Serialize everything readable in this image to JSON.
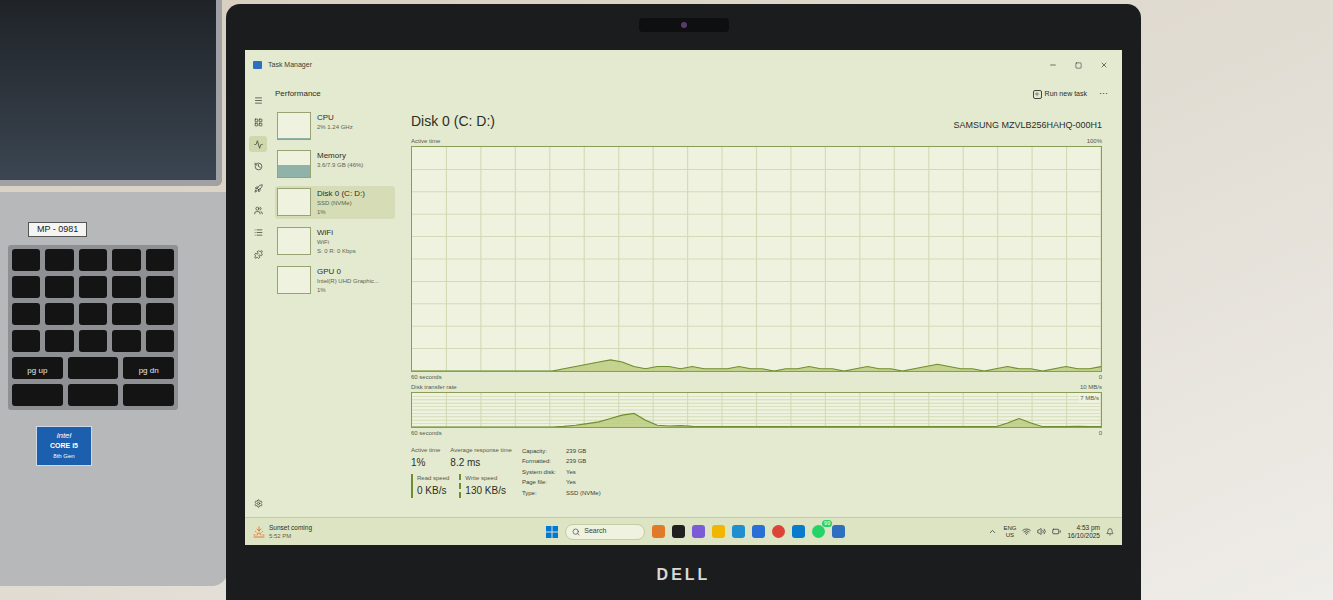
{
  "photo": {
    "left_laptop": {
      "asset_tag": "MP - 0981",
      "keyboard": [
        [
          "",
          "",
          "",
          "",
          ""
        ],
        [
          "",
          "",
          "",
          "",
          ""
        ],
        [
          "",
          "",
          "",
          "",
          ""
        ],
        [
          "",
          "",
          "",
          "",
          ""
        ],
        [
          "pg up",
          "",
          "pg dn"
        ],
        [
          "",
          "",
          ""
        ]
      ],
      "sticker": {
        "brand": "intel",
        "model": "CORE i5",
        "gen": "8th Gen"
      }
    },
    "bezel_logo": "DELL"
  },
  "window": {
    "title": "Task Manager"
  },
  "nav": [
    {
      "kind": "menu",
      "selected": false
    },
    {
      "kind": "processes",
      "selected": false
    },
    {
      "kind": "performance",
      "selected": true
    },
    {
      "kind": "history",
      "selected": false
    },
    {
      "kind": "startup",
      "selected": false
    },
    {
      "kind": "users",
      "selected": false
    },
    {
      "kind": "details",
      "selected": false
    },
    {
      "kind": "services",
      "selected": false
    },
    {
      "kind": "settings",
      "selected": false
    }
  ],
  "header": {
    "page": "Performance",
    "action": "Run new task",
    "more": "···"
  },
  "devices": [
    {
      "name": "CPU",
      "detail": "2% 1.24 GHz",
      "selected": false,
      "level": 0.02
    },
    {
      "name": "Memory",
      "detail": "3.6/7.9 GB (46%)",
      "selected": false,
      "level": 0.46
    },
    {
      "name": "Disk 0 (C: D:)",
      "detail": "SSD (NVMe)",
      "extra": "1%",
      "selected": true,
      "level": 0.01
    },
    {
      "name": "WiFi",
      "detail": "WiFi",
      "extra": "S: 0 R: 0 Kbps",
      "selected": false,
      "level": 0
    },
    {
      "name": "GPU 0",
      "detail": "Intel(R) UHD Graphic...",
      "extra": "1%",
      "selected": false,
      "level": 0.01
    }
  ],
  "disk": {
    "title": "Disk 0 (C: D:)",
    "model": "SAMSUNG MZVLB256HAHQ-000H1",
    "active_chart": {
      "label": "Active time",
      "max_label": "100%",
      "time_label": "60 seconds",
      "min_label": "0",
      "scale_max": 100,
      "values": [
        0,
        0,
        0,
        0,
        0,
        0,
        0,
        0,
        0,
        0,
        0,
        0,
        0,
        1,
        2,
        3,
        4,
        5,
        4,
        2,
        1,
        2,
        2,
        1,
        2,
        1,
        1,
        1,
        2,
        1,
        1,
        0,
        1,
        1,
        2,
        1,
        1,
        0,
        1,
        2,
        1,
        1,
        0,
        1,
        2,
        3,
        2,
        1,
        1,
        0,
        1,
        2,
        1,
        1,
        0,
        1,
        2,
        1,
        1,
        2
      ]
    },
    "transfer_chart": {
      "label": "Disk transfer rate",
      "max_label": "10 MB/s",
      "mid_label": "7 MB/s",
      "time_label": "60 seconds",
      "min_label": "0",
      "scale_max": 10,
      "values": [
        0,
        0,
        0,
        0,
        0,
        0,
        0,
        0,
        0,
        0,
        0,
        0,
        0,
        0.2,
        0.5,
        1,
        1.5,
        2.5,
        3.5,
        4,
        2,
        0.5,
        0.3,
        0.4,
        0.2,
        0.1,
        0.1,
        0.1,
        0.1,
        0.1,
        0.1,
        0.1,
        0.1,
        0.1,
        0.1,
        0.1,
        0.1,
        0.1,
        0.1,
        0.1,
        0.1,
        0.1,
        0.1,
        0.1,
        0.1,
        0.1,
        0.1,
        0.1,
        0.1,
        0.1,
        0.1,
        1.2,
        2.5,
        1.2,
        0.1,
        0.1,
        0.1,
        0.2,
        0.1,
        0.1
      ]
    },
    "stats": [
      {
        "label": "Active time",
        "value": "1%"
      },
      {
        "label": "Average response time",
        "value": "8.2 ms"
      }
    ],
    "speeds": [
      {
        "label": "Read speed",
        "value": "0 KB/s",
        "kind": "read"
      },
      {
        "label": "Write speed",
        "value": "130 KB/s",
        "kind": "write"
      }
    ],
    "properties": [
      {
        "label": "Capacity:",
        "value": "239 GB"
      },
      {
        "label": "Formatted:",
        "value": "239 GB"
      },
      {
        "label": "System disk:",
        "value": "Yes"
      },
      {
        "label": "Page file:",
        "value": "Yes"
      },
      {
        "label": "Type:",
        "value": "SSD (NVMe)"
      }
    ]
  },
  "taskbar": {
    "weather": {
      "title": "Sunset coming",
      "time": "5:52 PM"
    },
    "search": {
      "placeholder": "Search"
    },
    "apps": [
      {
        "kind": "game",
        "color": "#e07a2a"
      },
      {
        "kind": "terminal",
        "color": "#202020"
      },
      {
        "kind": "copilot",
        "color": "#7c5cd6"
      },
      {
        "kind": "folder",
        "color": "#f2b500"
      },
      {
        "kind": "edge",
        "color": "#1f8fcf"
      },
      {
        "kind": "store",
        "color": "#2a6fd6"
      },
      {
        "kind": "chrome",
        "color": "#db4437"
      },
      {
        "kind": "vscode",
        "color": "#0a7acc"
      },
      {
        "kind": "whatsapp",
        "color": "#25d366",
        "badge": "99"
      },
      {
        "kind": "taskmanager",
        "color": "#2e6fbf"
      }
    ],
    "tray": {
      "lang": "ENG",
      "region": "US"
    },
    "clock": {
      "time": "4:53 pm",
      "date": "16/10/2025"
    }
  }
}
